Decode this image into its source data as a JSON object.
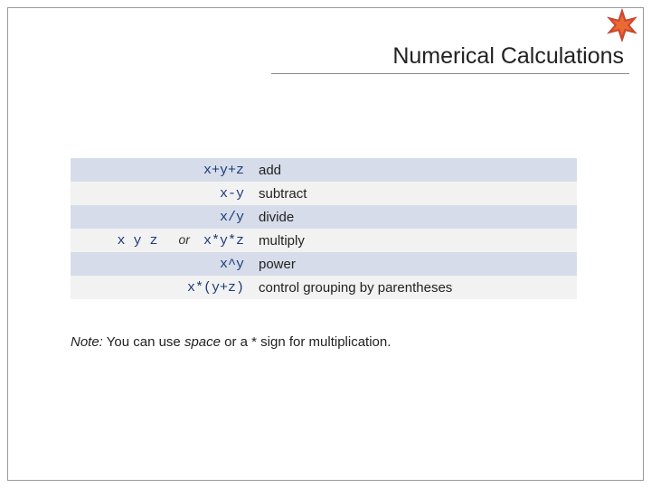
{
  "title": "Numerical Calculations",
  "rows": [
    {
      "expr": "x+y+z",
      "desc": "add"
    },
    {
      "expr": "x-y",
      "desc": "subtract"
    },
    {
      "expr": "x/y",
      "desc": "divide"
    },
    {
      "alt": "x y z",
      "or": "or",
      "expr": "x*y*z",
      "desc": "multiply"
    },
    {
      "expr": "x^y",
      "desc": "power"
    },
    {
      "expr": "x*(y+z)",
      "desc": "control grouping by parentheses"
    }
  ],
  "note": {
    "label": "Note:",
    "before": " You can use ",
    "space_word": "space",
    "after": " or a * sign for multiplication."
  }
}
